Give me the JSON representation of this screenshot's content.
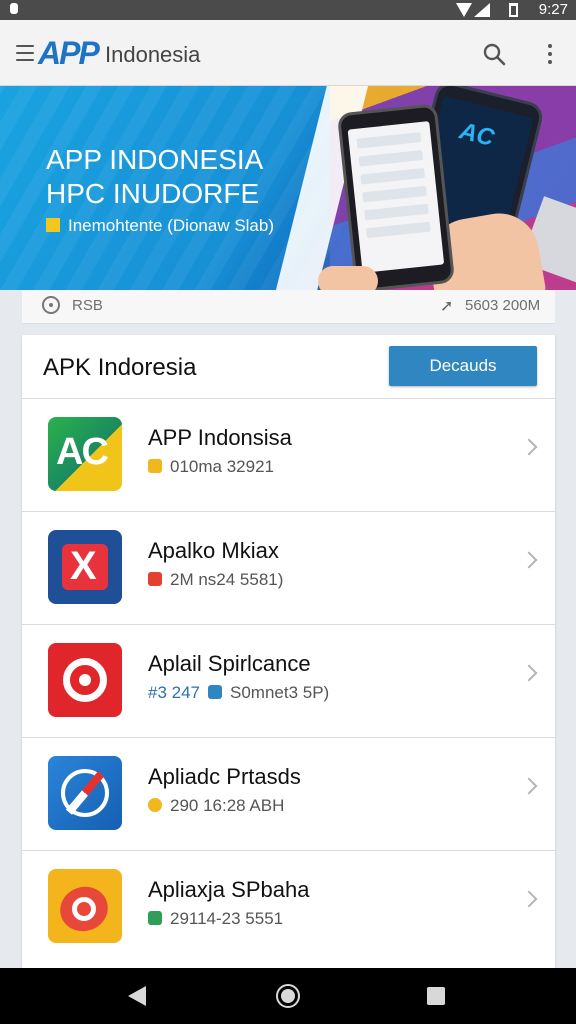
{
  "status_bar": {
    "time": "9:27",
    "icons": [
      "notification-icon",
      "wifi-icon",
      "signal-icon",
      "battery-icon"
    ]
  },
  "app_bar": {
    "logo_text": "APP",
    "brand_name": "Indonesia",
    "icons": [
      "menu-icon",
      "search-icon",
      "more-vert-icon"
    ]
  },
  "banner": {
    "title": "APP INDONESIA",
    "subtitle": "HPC INUDORFE",
    "tagline": "Inemohtente (Dionaw Slab)",
    "phone_logo": "AC"
  },
  "info_strip": {
    "left_label": "RSB",
    "right_label": "5603 200M"
  },
  "list_section": {
    "title": "APK Indoresia",
    "button_label": "Decauds"
  },
  "apps": [
    {
      "name": "APP Indonsisa",
      "meta": "010ma 32921",
      "meta_prefix": "",
      "icon_color": "#f0b81c",
      "icon": "ac-app-icon",
      "logo_text": "AC"
    },
    {
      "name": "Apalko Mkiax",
      "meta": "2M ns24 5581)",
      "meta_prefix": "",
      "icon_color": "#e0422f",
      "icon": "x-app-icon",
      "logo_text": "X"
    },
    {
      "name": "Aplail Spirlcance",
      "meta": "S0mnet3 5P)",
      "meta_prefix": "#3 247",
      "icon_color": "#2f86c0",
      "icon": "target-app-icon",
      "logo_text": ""
    },
    {
      "name": "Apliadc Prtasds",
      "meta": "290 16:28 ABH",
      "meta_prefix": "",
      "icon_color": "#f0b81c",
      "icon": "compass-app-icon",
      "logo_text": ""
    },
    {
      "name": "Apliaxja SPbaha",
      "meta": "29114-23 5551",
      "meta_prefix": "",
      "icon_color": "#2f9e58",
      "icon": "bullseye-app-icon",
      "logo_text": ""
    }
  ],
  "colors": {
    "accent": "#2f86c0",
    "logo_blue": "#1f73c4",
    "status_bar": "#4b4b4b",
    "nav_bar": "#000000"
  }
}
